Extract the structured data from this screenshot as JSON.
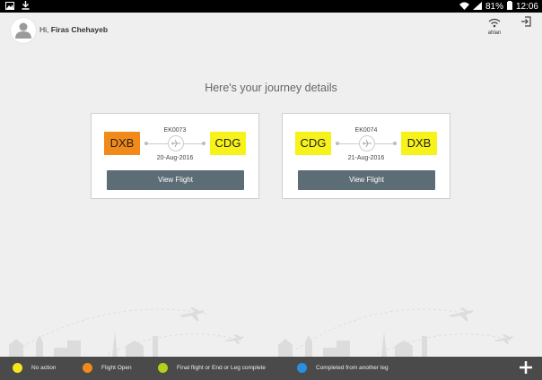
{
  "status_bar": {
    "battery": "81%",
    "time": "12:06"
  },
  "header": {
    "greeting": "Hi, ",
    "user_name": "Firas Chehayeb",
    "wifi_label": "ahlan"
  },
  "headline": "Here's your journey details",
  "journeys": [
    {
      "from": "DXB",
      "to": "CDG",
      "flight_no": "EK0073",
      "date": "20-Aug-2016",
      "button": "View Flight",
      "from_color": "#f28a1a",
      "to_color": "#f7f21a"
    },
    {
      "from": "CDG",
      "to": "DXB",
      "flight_no": "EK0074",
      "date": "21-Aug-2016",
      "button": "View Flight",
      "from_color": "#f7f21a",
      "to_color": "#f7f21a"
    }
  ],
  "legend": [
    {
      "label": "No action",
      "color": "#f5e71a"
    },
    {
      "label": "Flight Open",
      "color": "#f08a1a"
    },
    {
      "label": "Final flight or End or Leg complete",
      "color": "#b5cf1a"
    },
    {
      "label": "Completed from another leg",
      "color": "#2b8fe0"
    }
  ]
}
